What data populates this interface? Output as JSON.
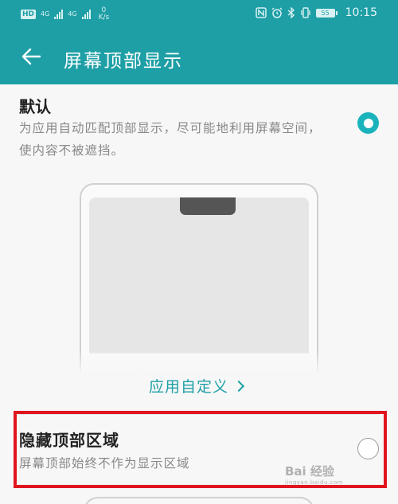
{
  "status_bar": {
    "hd_badge": "HD",
    "signal1_label": "4G",
    "signal2_label": "4G",
    "net_speed_value": "0",
    "net_speed_unit": "K/s",
    "battery": "55",
    "time": "10:15",
    "icons": [
      "nfc-icon",
      "alarm-icon",
      "bluetooth-icon",
      "vibrate-icon",
      "battery-icon"
    ]
  },
  "header": {
    "title": "屏幕顶部显示",
    "back_icon": "back-arrow-icon"
  },
  "options": [
    {
      "title": "默认",
      "description": "为应用自动匹配顶部显示，尽可能地利用屏幕空间，使内容不被遮挡。",
      "selected": true
    },
    {
      "title": "隐藏顶部区域",
      "description": "屏幕顶部始终不作为显示区域",
      "selected": false
    }
  ],
  "customize_link": "应用自定义",
  "watermark": {
    "text": "Bai 经验",
    "sub": "jingyan.baidu.com"
  },
  "colors": {
    "accent": "#1e9fa6",
    "radio_selected": "#1ab3bc",
    "highlight_box": "#e0151f"
  }
}
